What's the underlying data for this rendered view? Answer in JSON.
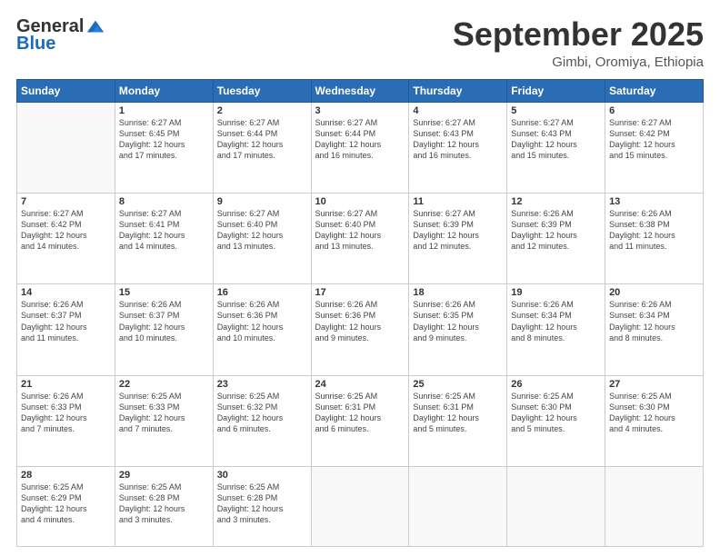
{
  "header": {
    "logo_general": "General",
    "logo_blue": "Blue",
    "month_title": "September 2025",
    "location": "Gimbi, Oromiya, Ethiopia"
  },
  "days_of_week": [
    "Sunday",
    "Monday",
    "Tuesday",
    "Wednesday",
    "Thursday",
    "Friday",
    "Saturday"
  ],
  "weeks": [
    [
      {
        "num": "",
        "info": ""
      },
      {
        "num": "1",
        "info": "Sunrise: 6:27 AM\nSunset: 6:45 PM\nDaylight: 12 hours\nand 17 minutes."
      },
      {
        "num": "2",
        "info": "Sunrise: 6:27 AM\nSunset: 6:44 PM\nDaylight: 12 hours\nand 17 minutes."
      },
      {
        "num": "3",
        "info": "Sunrise: 6:27 AM\nSunset: 6:44 PM\nDaylight: 12 hours\nand 16 minutes."
      },
      {
        "num": "4",
        "info": "Sunrise: 6:27 AM\nSunset: 6:43 PM\nDaylight: 12 hours\nand 16 minutes."
      },
      {
        "num": "5",
        "info": "Sunrise: 6:27 AM\nSunset: 6:43 PM\nDaylight: 12 hours\nand 15 minutes."
      },
      {
        "num": "6",
        "info": "Sunrise: 6:27 AM\nSunset: 6:42 PM\nDaylight: 12 hours\nand 15 minutes."
      }
    ],
    [
      {
        "num": "7",
        "info": "Sunrise: 6:27 AM\nSunset: 6:42 PM\nDaylight: 12 hours\nand 14 minutes."
      },
      {
        "num": "8",
        "info": "Sunrise: 6:27 AM\nSunset: 6:41 PM\nDaylight: 12 hours\nand 14 minutes."
      },
      {
        "num": "9",
        "info": "Sunrise: 6:27 AM\nSunset: 6:40 PM\nDaylight: 12 hours\nand 13 minutes."
      },
      {
        "num": "10",
        "info": "Sunrise: 6:27 AM\nSunset: 6:40 PM\nDaylight: 12 hours\nand 13 minutes."
      },
      {
        "num": "11",
        "info": "Sunrise: 6:27 AM\nSunset: 6:39 PM\nDaylight: 12 hours\nand 12 minutes."
      },
      {
        "num": "12",
        "info": "Sunrise: 6:26 AM\nSunset: 6:39 PM\nDaylight: 12 hours\nand 12 minutes."
      },
      {
        "num": "13",
        "info": "Sunrise: 6:26 AM\nSunset: 6:38 PM\nDaylight: 12 hours\nand 11 minutes."
      }
    ],
    [
      {
        "num": "14",
        "info": "Sunrise: 6:26 AM\nSunset: 6:37 PM\nDaylight: 12 hours\nand 11 minutes."
      },
      {
        "num": "15",
        "info": "Sunrise: 6:26 AM\nSunset: 6:37 PM\nDaylight: 12 hours\nand 10 minutes."
      },
      {
        "num": "16",
        "info": "Sunrise: 6:26 AM\nSunset: 6:36 PM\nDaylight: 12 hours\nand 10 minutes."
      },
      {
        "num": "17",
        "info": "Sunrise: 6:26 AM\nSunset: 6:36 PM\nDaylight: 12 hours\nand 9 minutes."
      },
      {
        "num": "18",
        "info": "Sunrise: 6:26 AM\nSunset: 6:35 PM\nDaylight: 12 hours\nand 9 minutes."
      },
      {
        "num": "19",
        "info": "Sunrise: 6:26 AM\nSunset: 6:34 PM\nDaylight: 12 hours\nand 8 minutes."
      },
      {
        "num": "20",
        "info": "Sunrise: 6:26 AM\nSunset: 6:34 PM\nDaylight: 12 hours\nand 8 minutes."
      }
    ],
    [
      {
        "num": "21",
        "info": "Sunrise: 6:26 AM\nSunset: 6:33 PM\nDaylight: 12 hours\nand 7 minutes."
      },
      {
        "num": "22",
        "info": "Sunrise: 6:25 AM\nSunset: 6:33 PM\nDaylight: 12 hours\nand 7 minutes."
      },
      {
        "num": "23",
        "info": "Sunrise: 6:25 AM\nSunset: 6:32 PM\nDaylight: 12 hours\nand 6 minutes."
      },
      {
        "num": "24",
        "info": "Sunrise: 6:25 AM\nSunset: 6:31 PM\nDaylight: 12 hours\nand 6 minutes."
      },
      {
        "num": "25",
        "info": "Sunrise: 6:25 AM\nSunset: 6:31 PM\nDaylight: 12 hours\nand 5 minutes."
      },
      {
        "num": "26",
        "info": "Sunrise: 6:25 AM\nSunset: 6:30 PM\nDaylight: 12 hours\nand 5 minutes."
      },
      {
        "num": "27",
        "info": "Sunrise: 6:25 AM\nSunset: 6:30 PM\nDaylight: 12 hours\nand 4 minutes."
      }
    ],
    [
      {
        "num": "28",
        "info": "Sunrise: 6:25 AM\nSunset: 6:29 PM\nDaylight: 12 hours\nand 4 minutes."
      },
      {
        "num": "29",
        "info": "Sunrise: 6:25 AM\nSunset: 6:28 PM\nDaylight: 12 hours\nand 3 minutes."
      },
      {
        "num": "30",
        "info": "Sunrise: 6:25 AM\nSunset: 6:28 PM\nDaylight: 12 hours\nand 3 minutes."
      },
      {
        "num": "",
        "info": ""
      },
      {
        "num": "",
        "info": ""
      },
      {
        "num": "",
        "info": ""
      },
      {
        "num": "",
        "info": ""
      }
    ]
  ]
}
